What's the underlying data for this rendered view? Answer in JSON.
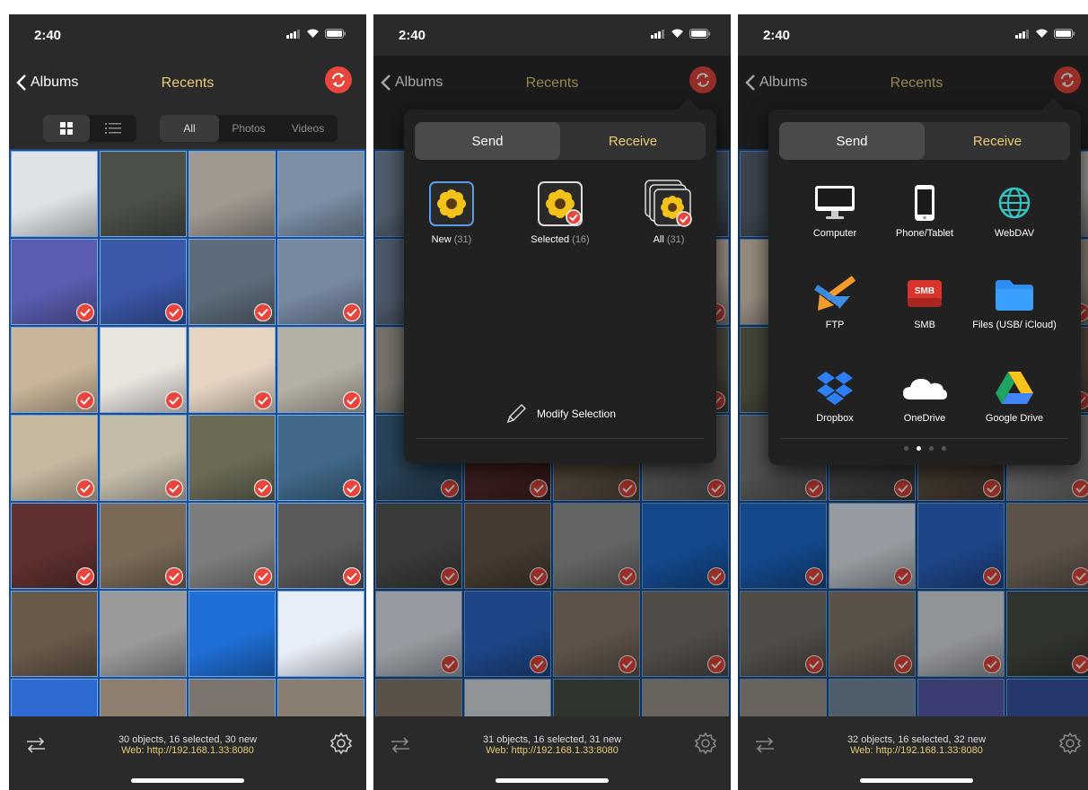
{
  "status": {
    "time": "2:40"
  },
  "nav": {
    "back_label": "Albums",
    "title": "Recents"
  },
  "filters": {
    "all": "All",
    "photos": "Photos",
    "videos": "Videos"
  },
  "panel1": {
    "info": "30 objects, 16 selected, 30 new",
    "web": "Web: http://192.168.1.33:8080"
  },
  "panel2": {
    "info": "31 objects, 16 selected, 31 new",
    "web": "Web: http://192.168.1.33:8080",
    "tabs": {
      "send": "Send",
      "receive": "Receive"
    },
    "options": [
      {
        "label": "New",
        "count": "(31)"
      },
      {
        "label": "Selected",
        "count": "(16)"
      },
      {
        "label": "All",
        "count": "(31)"
      }
    ],
    "modify": "Modify Selection"
  },
  "panel3": {
    "info": "32 objects, 16 selected, 32 new",
    "web": "Web: http://192.168.1.33:8080",
    "tabs": {
      "send": "Send",
      "receive": "Receive"
    },
    "destinations": [
      "Computer",
      "Phone/Tablet",
      "WebDAV",
      "FTP",
      "SMB",
      "Files (USB/ iCloud)",
      "Dropbox",
      "OneDrive",
      "Google Drive"
    ],
    "smb_logo_text": "SMB",
    "page_dots": [
      false,
      true,
      false,
      false
    ]
  },
  "thumbnails": {
    "colors": [
      "#dfe3e8",
      "#4b5048",
      "#a09990",
      "#7c8fa5",
      "#5a5db0",
      "#3a57a8",
      "#5d6b7a",
      "#7788a0",
      "#c9b59a",
      "#e8e4de",
      "#e6d4c2",
      "#b5b0a5",
      "#c7b8a0",
      "#c4bba9",
      "#6a6a55",
      "#40698a",
      "#603030",
      "#7a6a58",
      "#7d7d7d",
      "#5a5a5a",
      "#6a5a4a",
      "#9a9a9a",
      "#1f6fd6",
      "#e8eef7",
      "#2d6bd0",
      "#8e7e70",
      "#7b756d",
      "#8a7e70"
    ],
    "checked": [
      false,
      false,
      false,
      false,
      true,
      true,
      true,
      true,
      true,
      true,
      true,
      true,
      true,
      true,
      true,
      true,
      true,
      true,
      true,
      true,
      false,
      false,
      false,
      false,
      false,
      false,
      false,
      false
    ]
  },
  "colors": {
    "accent": "#e8463d",
    "gold": "#e9cb76",
    "selection_blue": "#1d4d8e"
  }
}
